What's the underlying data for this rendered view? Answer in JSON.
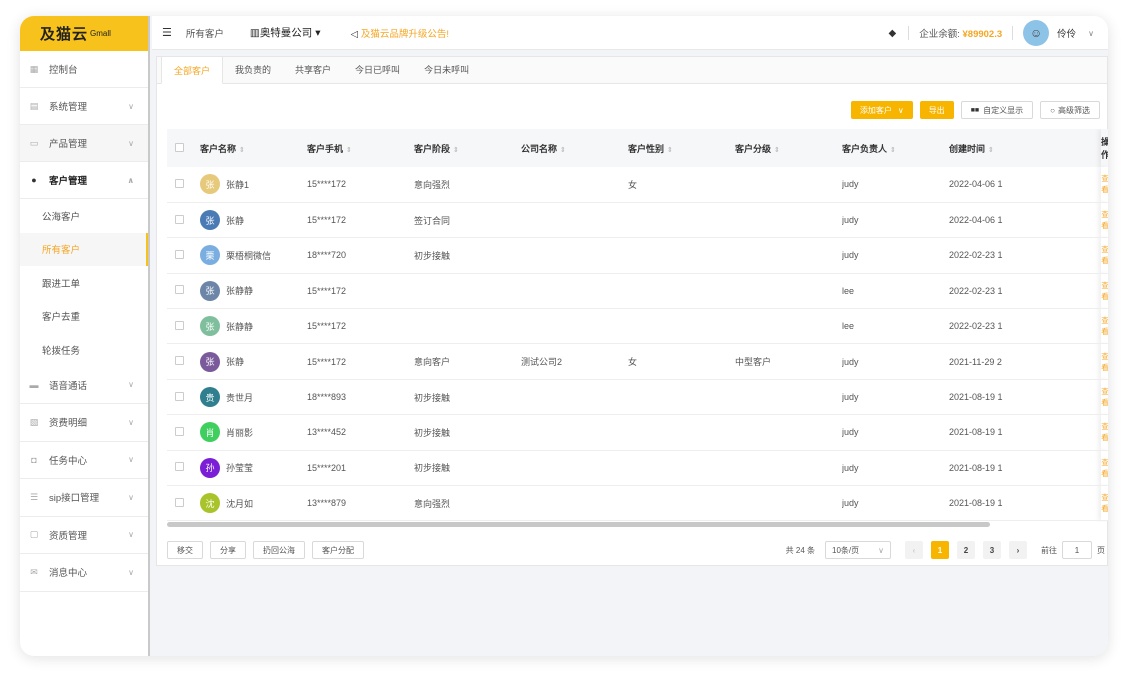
{
  "app": {
    "logo_text": "及猫云",
    "logo_sub": "Gmall"
  },
  "sidebar": {
    "items": [
      {
        "label": "控制台",
        "icon": "dashboard-icon",
        "glyph": "▦"
      },
      {
        "label": "系统管理",
        "icon": "system-icon",
        "glyph": "▤"
      },
      {
        "label": "产品管理",
        "icon": "product-icon",
        "glyph": "▭"
      },
      {
        "label": "客户管理",
        "icon": "user-icon",
        "glyph": "●"
      }
    ],
    "sub_items": [
      "公海客户",
      "所有客户",
      "跟进工单",
      "客户去重",
      "轮拨任务"
    ],
    "items_after": [
      {
        "label": "语音通话",
        "icon": "chat-icon",
        "glyph": "▬"
      },
      {
        "label": "资费明细",
        "icon": "doc-icon",
        "glyph": "▧"
      },
      {
        "label": "任务中心",
        "icon": "task-icon",
        "glyph": "◘"
      },
      {
        "label": "sip接口管理",
        "icon": "list-icon",
        "glyph": "☰"
      },
      {
        "label": "资质管理",
        "icon": "book-icon",
        "glyph": "▢"
      },
      {
        "label": "消息中心",
        "icon": "mail-icon",
        "glyph": "✉"
      }
    ]
  },
  "topbar": {
    "breadcrumb": "所有客户",
    "company": "奥特曼公司",
    "notice": "及猫云品牌升级公告!",
    "balance_label": "企业余额:",
    "balance_value": "¥89902.3",
    "username": "伶伶"
  },
  "tabs": [
    "全部客户",
    "我负责的",
    "共享客户",
    "今日已呼叫",
    "今日未呼叫"
  ],
  "actions": {
    "add": "添加客户",
    "export": "导出",
    "custom": "自定义显示",
    "filter": "高级筛选"
  },
  "table": {
    "headers": [
      "客户名称",
      "客户手机",
      "客户阶段",
      "公司名称",
      "客户性别",
      "客户分级",
      "客户负责人",
      "创建时间",
      "操作"
    ],
    "rows": [
      {
        "initial": "张",
        "color": "#e6c97a",
        "name": "张静1",
        "phone": "15****172",
        "stage": "意向强烈",
        "company": "",
        "gender": "女",
        "level": "",
        "owner": "judy",
        "created": "2022-04-06 1",
        "op": "查看"
      },
      {
        "initial": "张",
        "color": "#4a7bb5",
        "name": "张静",
        "phone": "15****172",
        "stage": "签订合同",
        "company": "",
        "gender": "",
        "level": "",
        "owner": "judy",
        "created": "2022-04-06 1",
        "op": "查看"
      },
      {
        "initial": "栗",
        "color": "#7aaee0",
        "name": "栗梧桐微信",
        "phone": "18****720",
        "stage": "初步接触",
        "company": "",
        "gender": "",
        "level": "",
        "owner": "judy",
        "created": "2022-02-23 1",
        "op": "查看"
      },
      {
        "initial": "张",
        "color": "#6d86a8",
        "name": "张静静",
        "phone": "15****172",
        "stage": "",
        "company": "",
        "gender": "",
        "level": "",
        "owner": "lee",
        "created": "2022-02-23 1",
        "op": "查看"
      },
      {
        "initial": "张",
        "color": "#7fbf9e",
        "name": "张静静",
        "phone": "15****172",
        "stage": "",
        "company": "",
        "gender": "",
        "level": "",
        "owner": "lee",
        "created": "2022-02-23 1",
        "op": "查看"
      },
      {
        "initial": "张",
        "color": "#7a5a9a",
        "name": "张静",
        "phone": "15****172",
        "stage": "意向客户",
        "company": "测试公司2",
        "gender": "女",
        "level": "中型客户",
        "owner": "judy",
        "created": "2021-11-29 2",
        "op": "查看"
      },
      {
        "initial": "贵",
        "color": "#2f7f8f",
        "name": "贵世月",
        "phone": "18****893",
        "stage": "初步接触",
        "company": "",
        "gender": "",
        "level": "",
        "owner": "judy",
        "created": "2021-08-19 1",
        "op": "查看"
      },
      {
        "initial": "肖",
        "color": "#3fcf5f",
        "name": "肖丽影",
        "phone": "13****452",
        "stage": "初步接触",
        "company": "",
        "gender": "",
        "level": "",
        "owner": "judy",
        "created": "2021-08-19 1",
        "op": "查看"
      },
      {
        "initial": "孙",
        "color": "#7a1fd6",
        "name": "孙莹莹",
        "phone": "15****201",
        "stage": "初步接触",
        "company": "",
        "gender": "",
        "level": "",
        "owner": "judy",
        "created": "2021-08-19 1",
        "op": "查看"
      },
      {
        "initial": "沈",
        "color": "#a8c42a",
        "name": "沈月如",
        "phone": "13****879",
        "stage": "意向强烈",
        "company": "",
        "gender": "",
        "level": "",
        "owner": "judy",
        "created": "2021-08-19 1",
        "op": "查看"
      }
    ]
  },
  "footer": {
    "buttons": [
      "移交",
      "分享",
      "扔回公海",
      "客户分配"
    ],
    "total": "共 24 条",
    "page_size": "10条/页",
    "pages": [
      "1",
      "2",
      "3"
    ],
    "goto_label": "前往",
    "goto_value": "1",
    "page_unit": "页"
  }
}
